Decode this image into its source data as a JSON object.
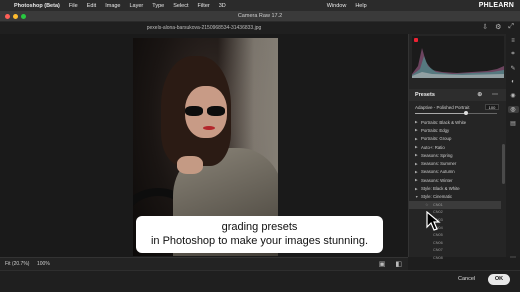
{
  "menubar": {
    "app": "Photoshop (Beta)",
    "items": [
      "File",
      "Edit",
      "Image",
      "Layer",
      "Type",
      "Select",
      "Filter",
      "3D",
      "Window",
      "Help"
    ],
    "brand": "PHLEARN"
  },
  "window": {
    "title": "Camera Raw 17.2"
  },
  "canvas": {
    "filename": "pexels-alona-barsukova-2150968534-31436833.jpg"
  },
  "presets": {
    "title": "Presets",
    "amount_label": "Adaptive - Polished Portrait",
    "amount_value": "100",
    "amount_fraction": 1.0,
    "groups": [
      "Portraits: Black & White",
      "Portraits: Edgy",
      "Portraits: Group",
      "Auto+: Ratio",
      "Seasons: Spring",
      "Seasons: Summer",
      "Seasons: Autumn",
      "Seasons: Winter",
      "Style: Black & White",
      "Style: Cinematic"
    ],
    "subitems": [
      "CN01",
      "CN02",
      "CN03",
      "CN04",
      "CN05",
      "CN06",
      "CN07",
      "CN08"
    ]
  },
  "bottom": {
    "fit_label": "Fit (20.7%)",
    "zoom_label": "100%",
    "cancel_label": "Cancel",
    "ok_label": "OK"
  },
  "caption": {
    "line1": "grading presets",
    "line2": "in Photoshop to make your images stunning."
  },
  "colors": {
    "accent": "#e8e8e8",
    "panel_bg": "#252525",
    "selected_row": "#3b3b3b"
  }
}
